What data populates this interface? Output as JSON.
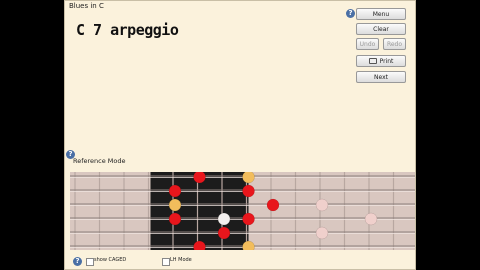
{
  "header": {
    "song_title": "Blues in C",
    "page_title": "C 7 arpeggio"
  },
  "buttons": {
    "menu": "Menu",
    "clear": "Clear",
    "undo": "Undo",
    "redo": "Redo",
    "print": "Print",
    "next": "Next"
  },
  "reference": {
    "label": "Reference Mode"
  },
  "footer": {
    "caged_label": "show CAGED",
    "lh_label": "LH Mode"
  },
  "help_glyph": "?",
  "colors": {
    "background": "#fbf2dc",
    "fretboard": "#d9c7c0",
    "highlight_region": "#1c1c1c",
    "note_red": "#e8161c",
    "note_gold": "#f2bd5c",
    "note_white": "#f4f0ee",
    "note_pink": "#f0d0cc"
  },
  "fretboard": {
    "strings": 6,
    "frets": 12,
    "highlighted_frets": [
      5,
      6,
      7,
      8
    ],
    "notes": [
      {
        "fret": 6,
        "string": 1,
        "color": "red"
      },
      {
        "fret": 8,
        "string": 1,
        "color": "gold"
      },
      {
        "fret": 5,
        "string": 2,
        "color": "red"
      },
      {
        "fret": 8,
        "string": 2,
        "color": "red"
      },
      {
        "fret": 5,
        "string": 3,
        "color": "gold"
      },
      {
        "fret": 9,
        "string": 3,
        "color": "red"
      },
      {
        "fret": 5,
        "string": 4,
        "color": "red"
      },
      {
        "fret": 7,
        "string": 4,
        "color": "white"
      },
      {
        "fret": 8,
        "string": 4,
        "color": "red"
      },
      {
        "fret": 11,
        "string": 3,
        "color": "pink"
      },
      {
        "fret": 13,
        "string": 4,
        "color": "pink"
      },
      {
        "fret": 7,
        "string": 5,
        "color": "red"
      },
      {
        "fret": 6,
        "string": 6,
        "color": "red"
      },
      {
        "fret": 8,
        "string": 6,
        "color": "gold"
      },
      {
        "fret": 11,
        "string": 5,
        "color": "pink"
      }
    ]
  }
}
